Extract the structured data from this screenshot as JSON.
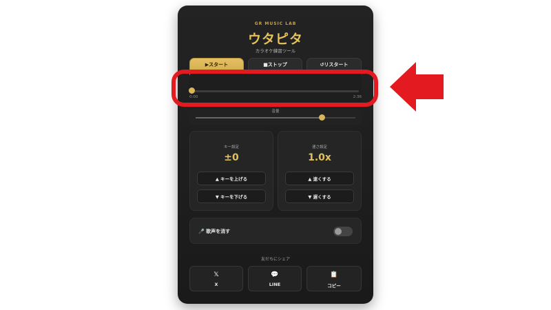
{
  "app": {
    "brand": "GR MUSIC LAB",
    "title": "ウタピタ",
    "subtitle": "カラオケ練習ツール"
  },
  "controls": {
    "start": "▶スタート",
    "stop": "■ストップ",
    "restart": "↺リスタート"
  },
  "player": {
    "current_time": "0:00",
    "duration": "2:36",
    "progress": 0.0
  },
  "volume": {
    "label": "音量",
    "level": 0.79
  },
  "key": {
    "label": "キー設定",
    "value": "±0",
    "up": "▲ キーを上げる",
    "down": "▼ キーを下げる"
  },
  "speed": {
    "label": "速さ設定",
    "value": "1.0x",
    "faster": "▲ 速くする",
    "slower": "▼ 遅くする"
  },
  "vocal": {
    "icon": "🎤",
    "label": "歌声を消す",
    "enabled": false
  },
  "share": {
    "label": "友だちにシェア",
    "x": {
      "icon": "𝕏",
      "label": "X"
    },
    "line": {
      "icon": "💬",
      "label": "LINE"
    },
    "copy": {
      "icon": "📋",
      "label": "コピー"
    }
  },
  "annotation": {
    "highlight_color": "#e31a1f",
    "arrow_color": "#e31a1f"
  }
}
